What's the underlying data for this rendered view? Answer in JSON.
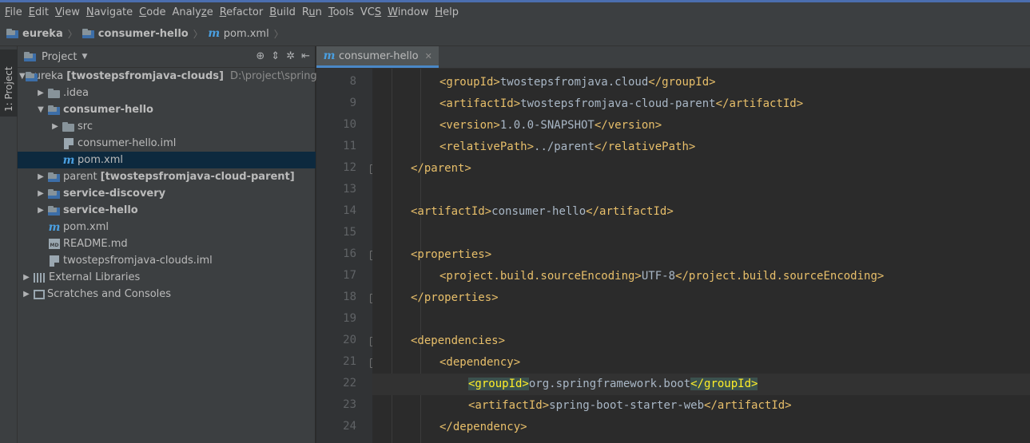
{
  "menu": [
    "File",
    "Edit",
    "View",
    "Navigate",
    "Code",
    "Analyze",
    "Refactor",
    "Build",
    "Run",
    "Tools",
    "VCS",
    "Window",
    "Help"
  ],
  "menu_mnemonics": [
    "F",
    "E",
    "V",
    "N",
    "C",
    "z",
    "R",
    "B",
    "u",
    "T",
    "S",
    "W",
    "H"
  ],
  "breadcrumbs": [
    {
      "label": "eureka",
      "icon": "module-folder-icon"
    },
    {
      "label": "consumer-hello",
      "icon": "module-folder-icon"
    },
    {
      "label": "pom.xml",
      "icon": "maven-icon"
    }
  ],
  "left_strip": {
    "tab_label": "1: Project"
  },
  "project_panel": {
    "title": "Project",
    "tree": [
      {
        "depth": 0,
        "arrow": "down",
        "icon": "module-folder-icon",
        "label": "eureka",
        "extra": "[twostepsfromjava-clouds]",
        "path": "D:\\project\\springClo",
        "bold": false
      },
      {
        "depth": 1,
        "arrow": "right",
        "icon": "folder-icon",
        "label": ".idea",
        "bold": false
      },
      {
        "depth": 1,
        "arrow": "down",
        "icon": "module-folder-icon",
        "label": "consumer-hello",
        "bold": true
      },
      {
        "depth": 2,
        "arrow": "right",
        "icon": "folder-icon",
        "label": "src",
        "bold": false
      },
      {
        "depth": 2,
        "arrow": "",
        "icon": "iml-file-icon",
        "label": "consumer-hello.iml",
        "bold": false
      },
      {
        "depth": 2,
        "arrow": "",
        "icon": "maven-icon",
        "label": "pom.xml",
        "bold": false,
        "selected": true
      },
      {
        "depth": 1,
        "arrow": "right",
        "icon": "module-folder-icon",
        "label": "parent",
        "extra": "[twostepsfromjava-cloud-parent]",
        "bold": false
      },
      {
        "depth": 1,
        "arrow": "right",
        "icon": "module-folder-icon",
        "label": "service-discovery",
        "bold": true
      },
      {
        "depth": 1,
        "arrow": "right",
        "icon": "module-folder-icon",
        "label": "service-hello",
        "bold": true
      },
      {
        "depth": 1,
        "arrow": "",
        "icon": "maven-icon",
        "label": "pom.xml",
        "bold": false
      },
      {
        "depth": 1,
        "arrow": "",
        "icon": "markdown-icon",
        "label": "README.md",
        "bold": false
      },
      {
        "depth": 1,
        "arrow": "",
        "icon": "iml-file-icon",
        "label": "twostepsfromjava-clouds.iml",
        "bold": false
      },
      {
        "depth": 0,
        "arrow": "right",
        "icon": "libraries-icon",
        "label": "External Libraries",
        "bold": false
      },
      {
        "depth": 0,
        "arrow": "right",
        "icon": "scratches-icon",
        "label": "Scratches and Consoles",
        "bold": false
      }
    ]
  },
  "editor": {
    "tab_label": "consumer-hello",
    "lines": [
      {
        "n": "8",
        "indent": 2,
        "tokens": [
          [
            "tag",
            "<groupId>"
          ],
          [
            "txt",
            "twostepsfromjava.cloud"
          ],
          [
            "tag",
            "</groupId>"
          ]
        ]
      },
      {
        "n": "9",
        "indent": 2,
        "tokens": [
          [
            "tag",
            "<artifactId>"
          ],
          [
            "txt",
            "twostepsfromjava-cloud-parent"
          ],
          [
            "tag",
            "</artifactId>"
          ]
        ]
      },
      {
        "n": "10",
        "indent": 2,
        "tokens": [
          [
            "tag",
            "<version>"
          ],
          [
            "txt",
            "1.0.0-SNAPSHOT"
          ],
          [
            "tag",
            "</version>"
          ]
        ]
      },
      {
        "n": "11",
        "indent": 2,
        "tokens": [
          [
            "tag",
            "<relativePath>"
          ],
          [
            "txt",
            "../parent"
          ],
          [
            "tag",
            "</relativePath>"
          ]
        ]
      },
      {
        "n": "12",
        "indent": 1,
        "fold": true,
        "tokens": [
          [
            "tag",
            "</parent>"
          ]
        ]
      },
      {
        "n": "13",
        "indent": 0,
        "tokens": []
      },
      {
        "n": "14",
        "indent": 1,
        "tokens": [
          [
            "tag",
            "<artifactId>"
          ],
          [
            "txt",
            "consumer-hello"
          ],
          [
            "tag",
            "</artifactId>"
          ]
        ]
      },
      {
        "n": "15",
        "indent": 0,
        "tokens": []
      },
      {
        "n": "16",
        "indent": 1,
        "fold": true,
        "tokens": [
          [
            "tag",
            "<properties>"
          ]
        ]
      },
      {
        "n": "17",
        "indent": 2,
        "tokens": [
          [
            "tag",
            "<project.build.sourceEncoding>"
          ],
          [
            "txt",
            "UTF-8"
          ],
          [
            "tag",
            "</project.build.sourceEncoding>"
          ]
        ]
      },
      {
        "n": "18",
        "indent": 1,
        "fold": true,
        "tokens": [
          [
            "tag",
            "</properties>"
          ]
        ]
      },
      {
        "n": "19",
        "indent": 0,
        "tokens": []
      },
      {
        "n": "20",
        "indent": 1,
        "fold": true,
        "tokens": [
          [
            "tag",
            "<dependencies>"
          ]
        ]
      },
      {
        "n": "21",
        "indent": 2,
        "fold": true,
        "tokens": [
          [
            "tag",
            "<dependency>"
          ]
        ]
      },
      {
        "n": "22",
        "indent": 3,
        "current": true,
        "tokens": [
          [
            "tag hl",
            "<groupId>"
          ],
          [
            "txt",
            "org.springframework.boot"
          ],
          [
            "tag hl",
            "</groupId>"
          ]
        ]
      },
      {
        "n": "23",
        "indent": 3,
        "tokens": [
          [
            "tag",
            "<artifactId>"
          ],
          [
            "txt",
            "spring-boot-starter-web"
          ],
          [
            "tag",
            "</artifactId>"
          ]
        ]
      },
      {
        "n": "24",
        "indent": 2,
        "tokens": [
          [
            "tag",
            "</dependency>"
          ]
        ]
      }
    ]
  }
}
